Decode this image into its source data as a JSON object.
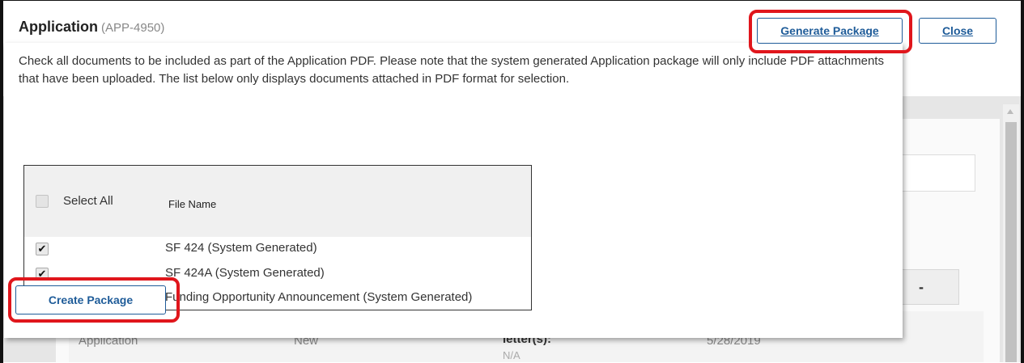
{
  "header": {
    "title": "Application",
    "app_id": "(APP-4950)",
    "generate_package_label": "Generate Package",
    "close_label": "Close"
  },
  "modal": {
    "instructions": "Check all documents to be included as part of the Application PDF. Please note that the system generated Application package will only include PDF attachments that have been uploaded. The list below only displays documents attached in PDF format for selection.",
    "table": {
      "select_all_label": "Select All",
      "column_header": "File Name",
      "rows": [
        {
          "file_name": "SF 424 (System Generated)",
          "checked": true
        },
        {
          "file_name": "SF 424A (System Generated)",
          "checked": true
        },
        {
          "file_name": "Funding Opportunity Announcement (System Generated)",
          "checked": true
        }
      ]
    },
    "create_package_label": "Create Package"
  },
  "background": {
    "collapse_label": "-",
    "row": {
      "type": "Application",
      "status": "New",
      "letters_label": "letter(s):",
      "letters_value": "N/A",
      "date": "5/28/2019"
    }
  },
  "colors": {
    "highlight": "#e0161c",
    "button_text": "#1f5c99"
  }
}
